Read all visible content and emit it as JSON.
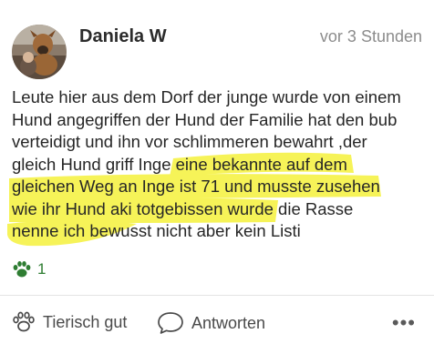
{
  "post": {
    "author": "Daniela W",
    "timestamp": "vor 3 Stunden",
    "body_lines": [
      "Leute hier aus dem Dorf der junge wurde von einem",
      "Hund angegriffen der Hund der Familie hat den bub",
      "verteidigt und ihn vor schlimmeren bewahrt ,der",
      "gleich Hund griff Inge eine bekannte auf dem",
      "gleichen Weg an Inge ist 71 und musste zusehen",
      "wie ihr Hund aki  totgebissen wurde die Rasse",
      "nenne ich bewusst nicht aber kein Listi"
    ],
    "reaction_count": "1",
    "highlight_color": "#f4f02a"
  },
  "actions": {
    "like_label": "Tierisch gut",
    "reply_label": "Antworten",
    "more_label": "•••"
  },
  "colors": {
    "accent": "#2e7d32",
    "text": "#262626",
    "muted": "#8c8c8c"
  },
  "icons": {
    "reaction": "paw-icon",
    "like": "paw-outline-icon",
    "reply": "speech-bubble-icon",
    "more": "more-dots-icon"
  }
}
